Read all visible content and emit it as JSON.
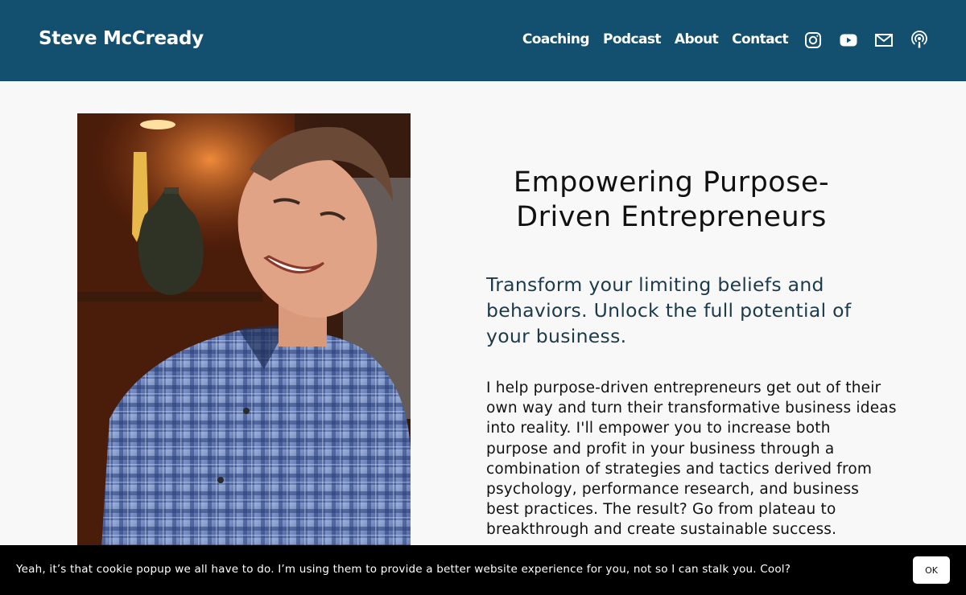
{
  "header": {
    "site_title": "Steve McCready",
    "nav": [
      {
        "label": "Coaching"
      },
      {
        "label": "Podcast"
      },
      {
        "label": "About"
      },
      {
        "label": "Contact"
      }
    ],
    "social_icons": [
      "instagram-icon",
      "youtube-icon",
      "mail-icon",
      "podcast-icon"
    ]
  },
  "main": {
    "headline": "Empowering Purpose-Driven Entrepreneurs",
    "subhead": "Transform your limiting beliefs and behaviors. Unlock the full potential of your business.",
    "body": "I help purpose-driven entrepreneurs get out of their own way and turn their transformative business ideas into reality. I'll empower you to increase both purpose and profit in your business through a combination of strategies and tactics derived from psychology, performance research, and business best practices. The result? Go from plateau to breakthrough and create sustainable success."
  },
  "cookie_banner": {
    "text": "Yeah, it’s that cookie popup we all have to do. I’m using them to provide a better website experience for you, not so I can stalk you. Cool?",
    "ok_label": "OK"
  },
  "colors": {
    "header_bg": "#134f6e",
    "page_bg": "#f8f8f8",
    "subhead": "#1c3a4a",
    "cookie_bg": "#000000"
  }
}
